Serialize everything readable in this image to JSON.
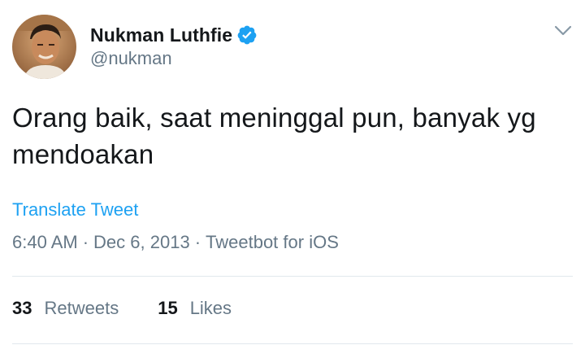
{
  "tweet": {
    "author": {
      "display_name": "Nukman Luthfie",
      "handle": "@nukman",
      "verified": true
    },
    "text": "Orang baik, saat meninggal pun, banyak yg mendoakan",
    "translate_label": "Translate Tweet",
    "meta": {
      "time": "6:40 AM",
      "separator": "·",
      "date": "Dec 6, 2013",
      "source": "Tweetbot for iOS"
    },
    "stats": {
      "retweets_count": "33",
      "retweets_label": "Retweets",
      "likes_count": "15",
      "likes_label": "Likes"
    }
  },
  "icons": {
    "verified": "verified-badge-icon",
    "menu": "chevron-down-icon"
  },
  "colors": {
    "link_blue": "#1da1f2",
    "secondary_text": "#657786",
    "primary_text": "#14171a",
    "divider": "#e1e8ed"
  }
}
